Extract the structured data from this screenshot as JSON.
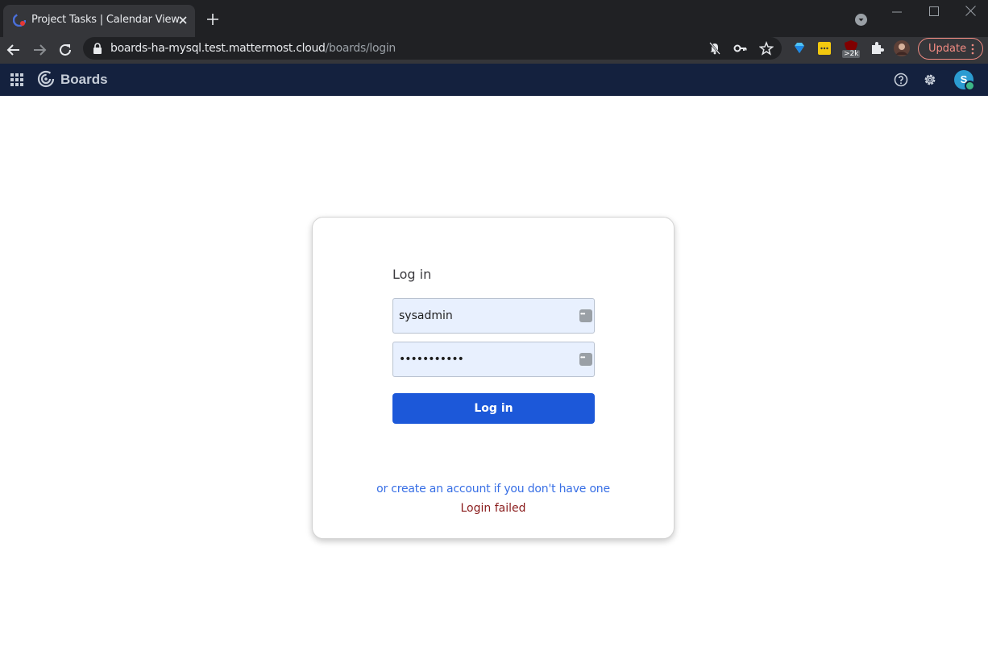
{
  "browser": {
    "tab_title": "Project Tasks | Calendar View",
    "url_host": "boards-ha-mysql.test.mattermost.cloud",
    "url_path": "/boards/login",
    "update_label": "Update",
    "extension_badge": ">2k"
  },
  "app": {
    "name": "Boards",
    "avatar_initial": "S"
  },
  "login": {
    "title": "Log in",
    "username_value": "sysadmin",
    "password_value": "•••••••••••",
    "button_label": "Log in",
    "create_account_link": "or create an account if you don't have one",
    "error_message": "Login failed"
  },
  "colors": {
    "app_header": "#14213e",
    "primary_button": "#1c58d9",
    "link": "#386fe5",
    "error": "#8a1c1c"
  }
}
